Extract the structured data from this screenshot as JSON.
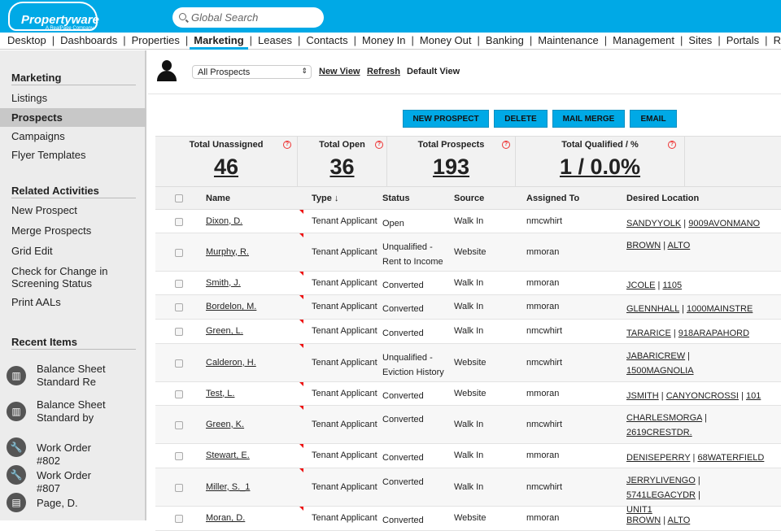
{
  "header": {
    "logo": "Propertyware",
    "logo_sub": "A RealPage Company",
    "search_placeholder": "Global Search"
  },
  "nav": [
    "Desktop",
    "Dashboards",
    "Properties",
    "Marketing",
    "Leases",
    "Contacts",
    "Money In",
    "Money Out",
    "Banking",
    "Maintenance",
    "Management",
    "Sites",
    "Portals",
    "Repo"
  ],
  "nav_active": "Marketing",
  "sidebar": {
    "marketing_title": "Marketing",
    "marketing_items": [
      "Listings",
      "Prospects",
      "Campaigns",
      "Flyer Templates"
    ],
    "selected": "Prospects",
    "related_title": "Related Activities",
    "related_items": [
      "New Prospect",
      "Merge Prospects",
      "Grid Edit",
      "Check for Change in Screening Status",
      "Print AALs"
    ],
    "recent_title": "Recent Items",
    "recent_items": [
      {
        "label": "Balance Sheet Standard Re",
        "icon": "chart-icon"
      },
      {
        "label": "Balance Sheet Standard by",
        "icon": "chart-icon"
      },
      {
        "label": "Work Order #802",
        "icon": "wrench-icon"
      },
      {
        "label": "Work Order #807",
        "icon": "wrench-icon"
      },
      {
        "label": "Page, D.",
        "icon": "document-icon"
      }
    ]
  },
  "toolbar": {
    "view": "All Prospects",
    "new_view": "New View",
    "refresh": "Refresh",
    "default_view": "Default View"
  },
  "actions": [
    "NEW PROSPECT",
    "DELETE",
    "MAIL MERGE",
    "EMAIL"
  ],
  "stats": [
    {
      "label": "Total Unassigned",
      "value": "46"
    },
    {
      "label": "Total Open",
      "value": "36"
    },
    {
      "label": "Total Prospects",
      "value": "193"
    },
    {
      "label": "Total Qualified / %",
      "value": "1 / 0.0%"
    }
  ],
  "columns": [
    "Name",
    "Type",
    "Status",
    "Source",
    "Assigned To",
    "Desired Location"
  ],
  "rows": [
    {
      "name": "Dixon, D.",
      "type": "Tenant Applicant",
      "status": "Open",
      "source": "Walk In",
      "assigned": "nmcwhirt",
      "location": "SANDYYOLK | 9009AVONMANO"
    },
    {
      "name": "Murphy, R.",
      "type": "Tenant Applicant",
      "status": "Unqualified - Rent to Income",
      "source": "Website",
      "assigned": "mmoran",
      "location": "BROWN | ALTO"
    },
    {
      "name": "Smith, J.",
      "type": "Tenant Applicant",
      "status": "Converted",
      "source": "Walk In",
      "assigned": "mmoran",
      "location": "JCOLE | 1105"
    },
    {
      "name": "Bordelon, M.",
      "type": "Tenant Applicant",
      "status": "Converted",
      "source": "Walk In",
      "assigned": "mmoran",
      "location": "GLENNHALL | 1000MAINSTRE"
    },
    {
      "name": "Green, L.",
      "type": "Tenant Applicant",
      "status": "Converted",
      "source": "Walk In",
      "assigned": "nmcwhirt",
      "location": "TARARICE | 918ARAPAHORD"
    },
    {
      "name": "Calderon, H.",
      "type": "Tenant Applicant",
      "status": "Unqualified - Eviction History",
      "source": "Website",
      "assigned": "nmcwhirt",
      "location": "JABARICREW | 1500MAGNOLIA"
    },
    {
      "name": "Test, L.",
      "type": "Tenant Applicant",
      "status": "Converted",
      "source": "Website",
      "assigned": "mmoran",
      "location": "JSMITH | CANYONCROSSI | 101"
    },
    {
      "name": "Green, K.",
      "type": "Tenant Applicant",
      "status": "Converted",
      "source": "Walk In",
      "assigned": "nmcwhirt",
      "location": "CHARLESMORGA | 2619CRESTDR."
    },
    {
      "name": "Stewart, E.",
      "type": "Tenant Applicant",
      "status": "Converted",
      "source": "Walk In",
      "assigned": "mmoran",
      "location": "DENISEPERRY | 68WATERFIELD"
    },
    {
      "name": "Miller, S._1",
      "type": "Tenant Applicant",
      "status": "Converted",
      "source": "Walk In",
      "assigned": "nmcwhirt",
      "location": "JERRYLIVENGO | 5741LEGACYDR | UNIT1"
    },
    {
      "name": "Moran, D.",
      "type": "Tenant Applicant",
      "status": "Converted",
      "source": "Website",
      "assigned": "mmoran",
      "location": "BROWN | ALTO"
    }
  ]
}
